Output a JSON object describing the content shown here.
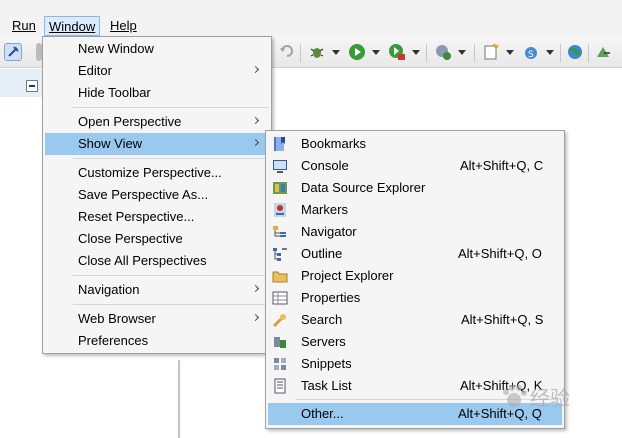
{
  "menubar": {
    "items": [
      {
        "label": "Run",
        "active": false
      },
      {
        "label": "Window",
        "active": true
      },
      {
        "label": "Help",
        "active": false
      }
    ]
  },
  "window_menu": {
    "items": [
      {
        "label": "New Window",
        "submenu": false
      },
      {
        "label": "Editor",
        "submenu": true
      },
      {
        "label": "Hide Toolbar",
        "submenu": false
      },
      {
        "label": "Open Perspective",
        "submenu": true
      },
      {
        "label": "Show View",
        "submenu": true,
        "highlighted": true
      },
      {
        "label": "Customize Perspective...",
        "submenu": false
      },
      {
        "label": "Save Perspective As...",
        "submenu": false
      },
      {
        "label": "Reset Perspective...",
        "submenu": false
      },
      {
        "label": "Close Perspective",
        "submenu": false
      },
      {
        "label": "Close All Perspectives",
        "submenu": false
      },
      {
        "label": "Navigation",
        "submenu": true
      },
      {
        "label": "Web Browser",
        "submenu": true
      },
      {
        "label": "Preferences",
        "submenu": false
      }
    ]
  },
  "show_view_menu": {
    "items": [
      {
        "label": "Bookmarks",
        "shortcut": "",
        "icon": "bookmarks-icon"
      },
      {
        "label": "Console",
        "shortcut": "Alt+Shift+Q, C",
        "icon": "console-icon"
      },
      {
        "label": "Data Source Explorer",
        "shortcut": "",
        "icon": "data-source-explorer-icon"
      },
      {
        "label": "Markers",
        "shortcut": "",
        "icon": "markers-icon"
      },
      {
        "label": "Navigator",
        "shortcut": "",
        "icon": "navigator-icon"
      },
      {
        "label": "Outline",
        "shortcut": "Alt+Shift+Q, O",
        "icon": "outline-icon"
      },
      {
        "label": "Project Explorer",
        "shortcut": "",
        "icon": "project-explorer-icon"
      },
      {
        "label": "Properties",
        "shortcut": "",
        "icon": "properties-icon"
      },
      {
        "label": "Search",
        "shortcut": "Alt+Shift+Q, S",
        "icon": "search-icon"
      },
      {
        "label": "Servers",
        "shortcut": "",
        "icon": "servers-icon"
      },
      {
        "label": "Snippets",
        "shortcut": "",
        "icon": "snippets-icon"
      },
      {
        "label": "Task List",
        "shortcut": "Alt+Shift+Q, K",
        "icon": "task-list-icon"
      },
      {
        "label": "Other...",
        "shortcut": "Alt+Shift+Q, Q",
        "icon": "",
        "highlighted": true
      }
    ]
  },
  "colors": {
    "highlight": "#99c9ef",
    "menubar_active": "#dcebfa"
  }
}
